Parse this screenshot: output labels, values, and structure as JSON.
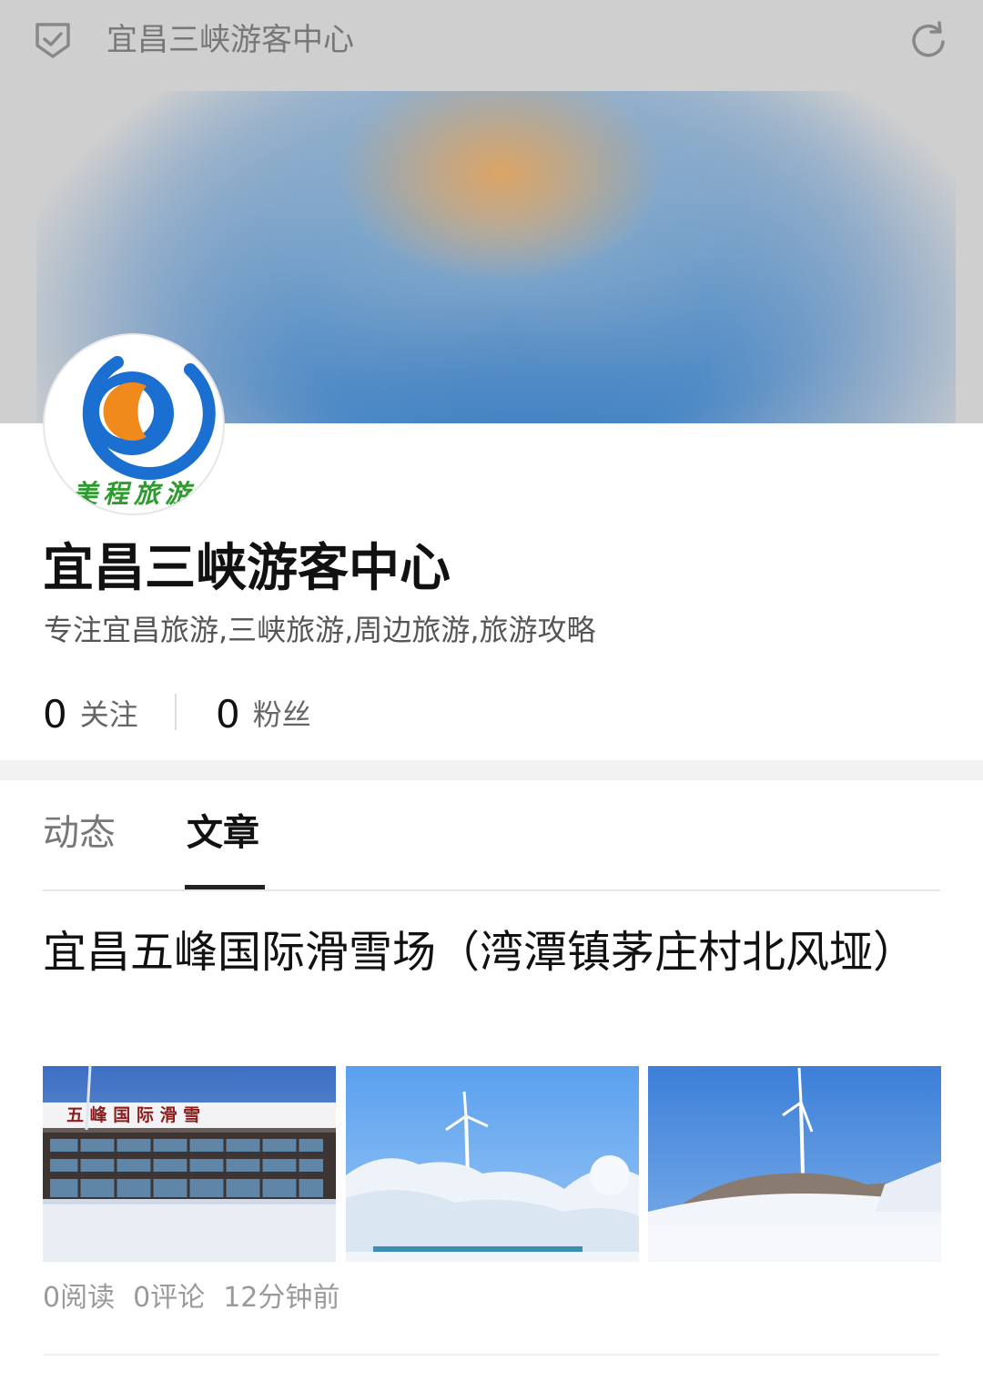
{
  "topbar": {
    "title": "宜昌三峡游客中心",
    "left_icon": "shield-check-icon",
    "right_icon": "refresh-icon"
  },
  "profile": {
    "avatar_logo_text": "美程旅游",
    "name": "宜昌三峡游客中心",
    "description": "专注宜昌旅游,三峡旅游,周边旅游,旅游攻略",
    "following_count": "0",
    "following_label": "关注",
    "followers_count": "0",
    "followers_label": "粉丝"
  },
  "tabs": [
    {
      "label": "动态",
      "active": false
    },
    {
      "label": "文章",
      "active": true
    }
  ],
  "article": {
    "title": "宜昌五峰国际滑雪场（湾潭镇茅庄村北风垭）",
    "thumbnail_sign_text": "五 峰 国 际 滑 雪",
    "reads": "0阅读",
    "comments": "0评论",
    "time": "12分钟前"
  },
  "colors": {
    "topbar_bg": "#cfcfcf",
    "banner_blue": "#1e6cbe",
    "banner_orange": "#e0a460",
    "logo_blue": "#1a6fd0",
    "logo_orange": "#f08a1c",
    "logo_green": "#2f9a2f",
    "tab_indicator": "#222222"
  }
}
